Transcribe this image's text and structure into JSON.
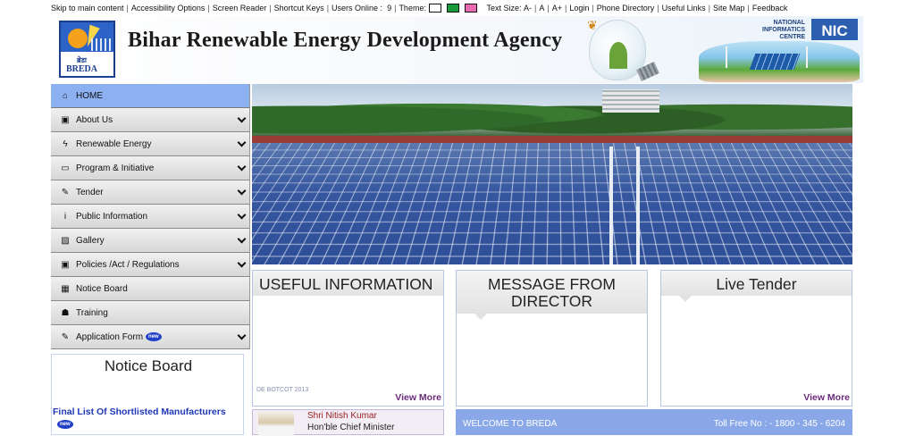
{
  "topbar": {
    "skip": "Skip to main content",
    "accessibility": "Accessibility Options",
    "screen_reader": "Screen Reader",
    "shortcut_keys": "Shortcut Keys",
    "users_online_label": "Users Online :",
    "users_online_count": "9",
    "theme_label": "Theme:",
    "theme_colors": [
      "#ffffff",
      "#1a9a3a",
      "#e86ab0"
    ],
    "text_size_label": "Text Size:",
    "text_size_decrease": "A-",
    "text_size_normal": "A",
    "text_size_increase": "A+",
    "login": "Login",
    "phone_directory": "Phone Directory",
    "useful_links": "Useful Links",
    "site_map": "Site Map",
    "feedback": "Feedback"
  },
  "header": {
    "title": "Bihar Renewable Energy Development Agency",
    "logo_hindi": "ब्रेडा",
    "logo_text": "BREDA",
    "nic_line1": "NATIONAL",
    "nic_line2": "INFORMATICS",
    "nic_line3": "CENTRE",
    "nic_logo": "NIC"
  },
  "sidebar": {
    "items": [
      {
        "label": "HOME",
        "icon": "home-icon",
        "glyph": "⌂",
        "chevron": false,
        "active": true
      },
      {
        "label": "About Us",
        "icon": "gift-icon",
        "glyph": "▣",
        "chevron": true
      },
      {
        "label": "Renewable Energy",
        "icon": "bolt-icon",
        "glyph": "ϟ",
        "chevron": true
      },
      {
        "label": "Program & Initiative",
        "icon": "keyboard-icon",
        "glyph": "▭",
        "chevron": true
      },
      {
        "label": "Tender",
        "icon": "edit-icon",
        "glyph": "✎",
        "chevron": true
      },
      {
        "label": "Public Information",
        "icon": "info-icon",
        "glyph": "i",
        "chevron": true
      },
      {
        "label": "Gallery",
        "icon": "image-icon",
        "glyph": "▨",
        "chevron": true
      },
      {
        "label": "Policies /Act / Regulations",
        "icon": "gift-icon",
        "glyph": "▣",
        "chevron": true
      },
      {
        "label": "Notice Board",
        "icon": "calculator-icon",
        "glyph": "▦",
        "chevron": false
      },
      {
        "label": "Training",
        "icon": "users-icon",
        "glyph": "☗",
        "chevron": false
      },
      {
        "label": "Application Form",
        "icon": "form-icon",
        "glyph": "✎",
        "chevron": true,
        "badge": "new"
      }
    ]
  },
  "notice_board": {
    "title": "Notice Board",
    "item": "Final List Of Shortlisted Manufacturers",
    "badge": "new"
  },
  "cards": {
    "useful_info": {
      "title": "USEFUL INFORMATION",
      "view_more": "View More",
      "faded": "DE BOTCOT 2013"
    },
    "director": {
      "title_line1": "MESSAGE FROM",
      "title_line2": "DIRECTOR"
    },
    "live_tender": {
      "title": "Live Tender",
      "view_more": "View More"
    }
  },
  "minister": {
    "name": "Shri Nitish Kumar",
    "role": "Hon'ble Chief Minister"
  },
  "welcome": {
    "left": "WELCOME TO BREDA",
    "right": "Toll Free No : - 1800 - 345 - 6204"
  }
}
